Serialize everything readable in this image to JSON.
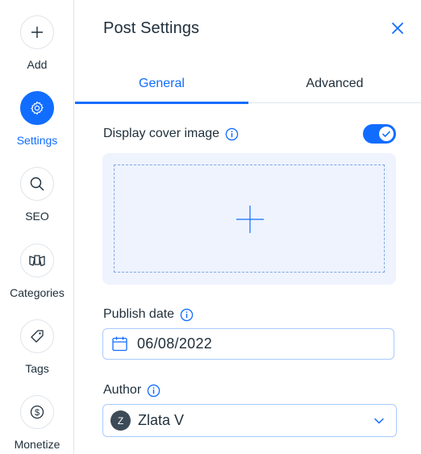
{
  "sidebar": {
    "items": [
      {
        "label": "Add",
        "icon": "plus-icon",
        "active": false
      },
      {
        "label": "Settings",
        "icon": "gear-icon",
        "active": true
      },
      {
        "label": "SEO",
        "icon": "search-icon",
        "active": false
      },
      {
        "label": "Categories",
        "icon": "categories-icon",
        "active": false
      },
      {
        "label": "Tags",
        "icon": "tag-icon",
        "active": false
      },
      {
        "label": "Monetize",
        "icon": "dollar-icon",
        "active": false
      }
    ]
  },
  "panel": {
    "title": "Post Settings",
    "close_icon": "close-icon"
  },
  "tabs": [
    {
      "label": "General",
      "active": true
    },
    {
      "label": "Advanced",
      "active": false
    }
  ],
  "cover": {
    "label": "Display cover image",
    "enabled": true,
    "add_icon": "plus-icon"
  },
  "publish_date": {
    "label": "Publish date",
    "value": "06/08/2022",
    "icon": "calendar-icon"
  },
  "author": {
    "label": "Author",
    "avatar_initial": "Z",
    "name": "Zlata V",
    "icon": "chevron-down-icon"
  },
  "colors": {
    "accent": "#116dff",
    "text": "#20303c",
    "border": "#dfe5eb",
    "cover_bg": "#eef3fe",
    "avatar_bg": "#3c4b57"
  }
}
